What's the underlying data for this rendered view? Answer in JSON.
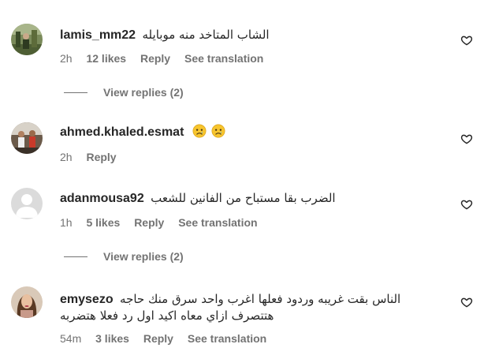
{
  "comments": [
    {
      "username": "lamis_mm22",
      "text": "الشاب المتاخد منه موبايله",
      "time": "2h",
      "likes": "12 likes",
      "reply": "Reply",
      "translate": "See translation",
      "view_replies": "View replies (2)",
      "avatar_icon": "profile-photo-green-outdoor"
    },
    {
      "username": "ahmed.khaled.esmat",
      "emoji_name": "sad-face-emoji",
      "time": "2h",
      "reply": "Reply",
      "avatar_icon": "profile-photo-people"
    },
    {
      "username": "adanmousa92",
      "text": "الضرب بقا مستباح من الفانين للشعب",
      "time": "1h",
      "likes": "5 likes",
      "reply": "Reply",
      "translate": "See translation",
      "view_replies": "View replies (2)",
      "avatar_icon": "default-avatar-gray"
    },
    {
      "username": "emysezo",
      "text": "الناس بقت غريبه وردود فعلها اغرب واحد سرق منك حاجه",
      "text_line2": "هتتصرف ازاي معاه اكيد اول رد فعلا هتضربه",
      "time": "54m",
      "likes": "3 likes",
      "reply": "Reply",
      "translate": "See translation",
      "avatar_icon": "profile-photo-woman"
    }
  ],
  "icons": {
    "like": "heart-outline-icon"
  },
  "colors": {
    "text_primary": "#262626",
    "text_secondary": "#737373",
    "background": "#ffffff"
  }
}
